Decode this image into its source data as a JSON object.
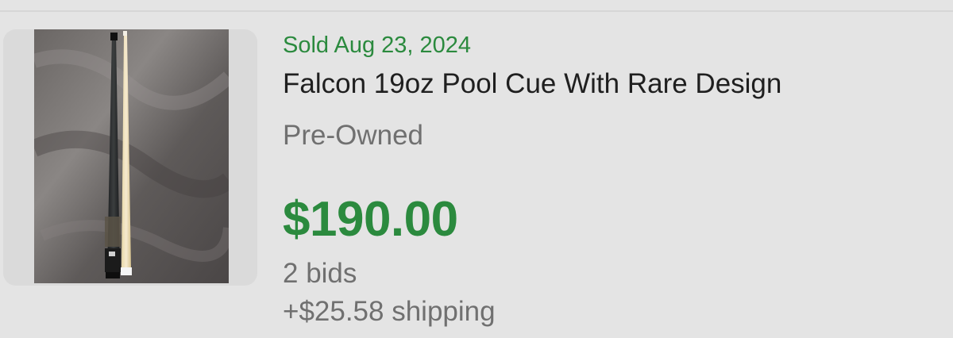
{
  "listing": {
    "image_alt": "pool-cue-photo",
    "sold_date": "Sold Aug 23, 2024",
    "title": "Falcon 19oz Pool Cue With Rare Design",
    "condition": "Pre-Owned",
    "price": "$190.00",
    "bids": "2 bids",
    "shipping": "+$25.58 shipping"
  },
  "colors": {
    "background": "#e4e4e4",
    "sold_green": "#2b8a3e",
    "title_text": "#1f1f1f",
    "secondary_text": "#707070"
  }
}
